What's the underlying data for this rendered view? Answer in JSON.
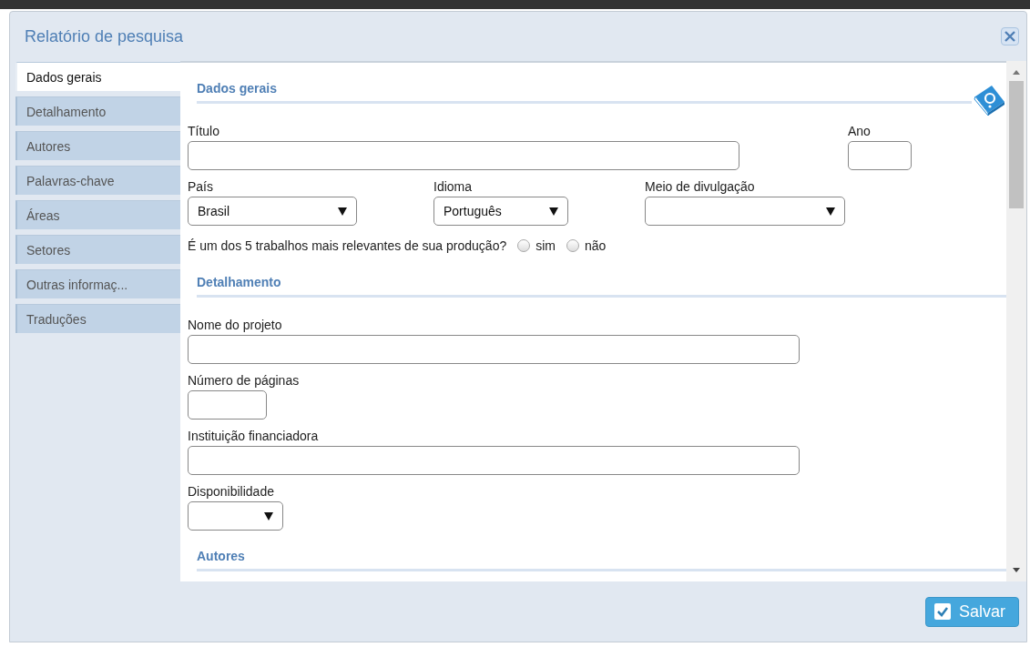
{
  "window": {
    "title": "Relatório de pesquisa"
  },
  "tabs": [
    {
      "label": "Dados gerais",
      "selected": true
    },
    {
      "label": "Detalhamento",
      "selected": false
    },
    {
      "label": "Autores",
      "selected": false
    },
    {
      "label": "Palavras-chave",
      "selected": false
    },
    {
      "label": "Áreas",
      "selected": false
    },
    {
      "label": "Setores",
      "selected": false
    },
    {
      "label": "Outras informaç...",
      "selected": false
    },
    {
      "label": "Traduções",
      "selected": false
    }
  ],
  "sections": [
    {
      "title": "Dados gerais",
      "help": true,
      "rows": [
        [
          {
            "kind": "text",
            "label": "Título"
          },
          {
            "kind": "text",
            "label": "Ano"
          }
        ],
        [
          {
            "kind": "select",
            "label": "País",
            "value": "Brasil"
          },
          {
            "kind": "select",
            "label": "Idioma",
            "value": "Português"
          },
          {
            "kind": "select",
            "label": "Meio de divulgação"
          }
        ],
        [
          {
            "kind": "question",
            "label": "É um dos 5 trabalhos mais relevantes de sua produção?",
            "options": [
              {
                "label": "sim",
                "selected": false
              },
              {
                "label": "não",
                "selected": false
              }
            ]
          }
        ]
      ]
    },
    {
      "title": "Detalhamento",
      "help": false,
      "rows": [
        [
          {
            "kind": "text",
            "label": "Nome do projeto"
          }
        ],
        [
          {
            "kind": "text",
            "label": "Número de páginas"
          }
        ],
        [
          {
            "kind": "text",
            "label": "Instituição financiadora"
          }
        ],
        [
          {
            "kind": "select",
            "label": "Disponibilidade"
          }
        ]
      ]
    },
    {
      "title": "Autores",
      "help": false
    }
  ],
  "save_button": {
    "label": "Salvar"
  }
}
